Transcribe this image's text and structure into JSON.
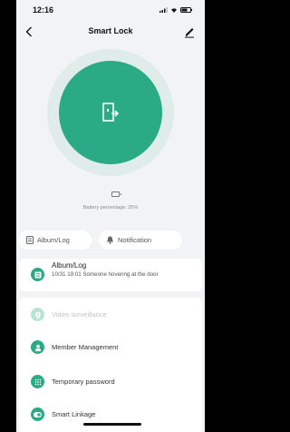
{
  "status_bar": {
    "time": "12:16"
  },
  "header": {
    "title": "Smart Lock",
    "back_icon": "chevron-left-icon",
    "edit_icon": "pen-icon"
  },
  "lock": {
    "icon": "door-exit-icon",
    "accent_color": "#2aab85"
  },
  "battery": {
    "text": "Battery percentage: 25%",
    "level": 0.25
  },
  "chips": [
    {
      "label": "Album/Log",
      "icon": "album-icon"
    },
    {
      "label": "Notification",
      "icon": "bell-icon"
    }
  ],
  "log": {
    "title": "Album/Log",
    "entry": "10/31 19:01 Someone hovering at the door"
  },
  "menu": [
    {
      "label": "Video surveillance",
      "icon": "camera-icon",
      "enabled": false
    },
    {
      "label": "Member Management",
      "icon": "person-icon",
      "enabled": true
    },
    {
      "label": "Temporary password",
      "icon": "keypad-icon",
      "enabled": true
    },
    {
      "label": "Smart Linkage",
      "icon": "toggle-icon",
      "enabled": true
    }
  ]
}
